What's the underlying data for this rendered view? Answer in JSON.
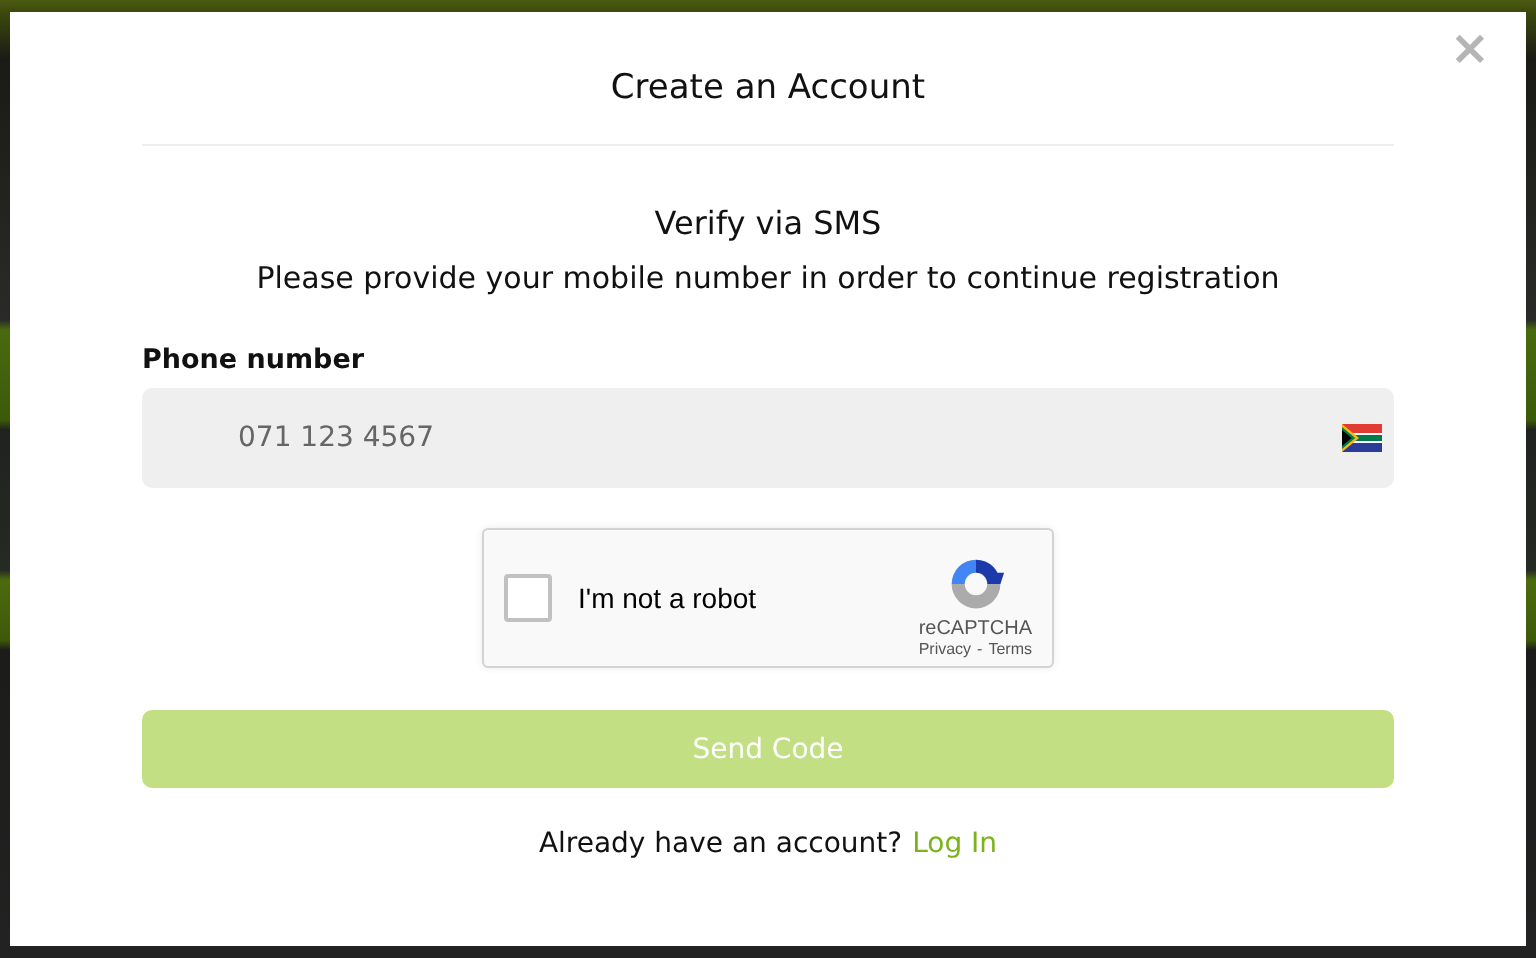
{
  "dialog": {
    "title": "Create an Account",
    "close": "×"
  },
  "verify": {
    "heading": "Verify via SMS",
    "text": "Please provide your mobile number in order to continue registration"
  },
  "phone": {
    "label": "Phone number",
    "placeholder": "071 123 4567"
  },
  "captcha": {
    "checked": false,
    "label": "I'm not a robot",
    "brand": "reCAPTCHA",
    "privacy": "Privacy",
    "separator": "-",
    "terms": "Terms"
  },
  "submit": {
    "label": "Send Code",
    "disabled": true
  },
  "footer": {
    "text": "Already have an account?",
    "link": "Log In"
  }
}
